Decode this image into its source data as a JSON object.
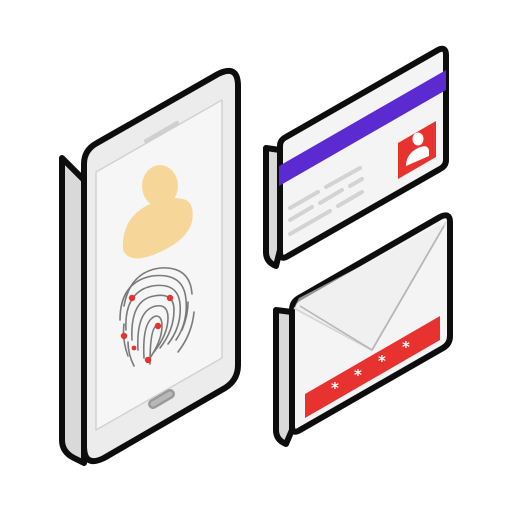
{
  "illustration": {
    "items": [
      "smartphone",
      "id-card",
      "envelope"
    ],
    "password_mask": "****"
  },
  "colors": {
    "outline": "#0d0d0d",
    "device_side": "#e1e1e1",
    "screen": "#f4f4f4",
    "accent_purple": "#5b2bd1",
    "accent_red": "#e8322f",
    "avatar_yellow": "#f6d799",
    "text_lines": "#d6d6d6",
    "fingerprint": "#777777"
  },
  "icons": [
    "user-icon",
    "fingerprint-icon",
    "id-card-icon",
    "envelope-icon",
    "password-asterisk-icon"
  ]
}
